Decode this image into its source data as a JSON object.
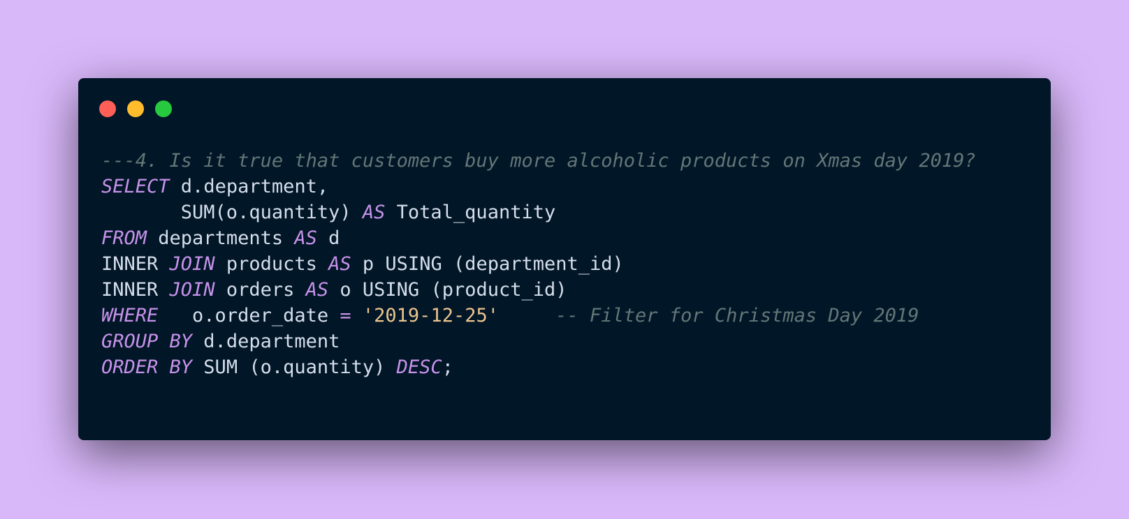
{
  "window": {
    "controls": [
      "close",
      "minimize",
      "zoom"
    ],
    "colors": {
      "background": "#011627",
      "page_background": "#d9b8fa",
      "close": "#ff5f56",
      "minimize": "#ffbd2e",
      "zoom": "#27c93f"
    }
  },
  "code": {
    "language": "sql",
    "lines": [
      [
        {
          "t": "cm",
          "v": "---4. Is it true that customers buy more alcoholic products on Xmas day 2019?"
        }
      ],
      [
        {
          "t": "kw",
          "v": "SELECT"
        },
        {
          "t": "tx",
          "v": " d.department,"
        }
      ],
      [
        {
          "t": "tx",
          "v": "       SUM(o.quantity) "
        },
        {
          "t": "kw",
          "v": "AS"
        },
        {
          "t": "tx",
          "v": " Total_quantity"
        }
      ],
      [
        {
          "t": "kw",
          "v": "FROM"
        },
        {
          "t": "tx",
          "v": " departments "
        },
        {
          "t": "kw",
          "v": "AS"
        },
        {
          "t": "tx",
          "v": " d"
        }
      ],
      [
        {
          "t": "tx",
          "v": "INNER "
        },
        {
          "t": "kw",
          "v": "JOIN"
        },
        {
          "t": "tx",
          "v": " products "
        },
        {
          "t": "kw",
          "v": "AS"
        },
        {
          "t": "tx",
          "v": " p USING (department_id)"
        }
      ],
      [
        {
          "t": "tx",
          "v": "INNER "
        },
        {
          "t": "kw",
          "v": "JOIN"
        },
        {
          "t": "tx",
          "v": " orders "
        },
        {
          "t": "kw",
          "v": "AS"
        },
        {
          "t": "tx",
          "v": " o USING (product_id)"
        }
      ],
      [
        {
          "t": "kw",
          "v": "WHERE"
        },
        {
          "t": "tx",
          "v": "   o.order_date "
        },
        {
          "t": "op",
          "v": "="
        },
        {
          "t": "tx",
          "v": " "
        },
        {
          "t": "str",
          "v": "'2019-12-25'"
        },
        {
          "t": "tx",
          "v": "     "
        },
        {
          "t": "cm",
          "v": "-- Filter for Christmas Day 2019"
        }
      ],
      [
        {
          "t": "kw",
          "v": "GROUP BY"
        },
        {
          "t": "tx",
          "v": " d.department"
        }
      ],
      [
        {
          "t": "kw",
          "v": "ORDER BY"
        },
        {
          "t": "tx",
          "v": " SUM (o.quantity) "
        },
        {
          "t": "kw",
          "v": "DESC"
        },
        {
          "t": "tx",
          "v": ";"
        }
      ]
    ]
  }
}
